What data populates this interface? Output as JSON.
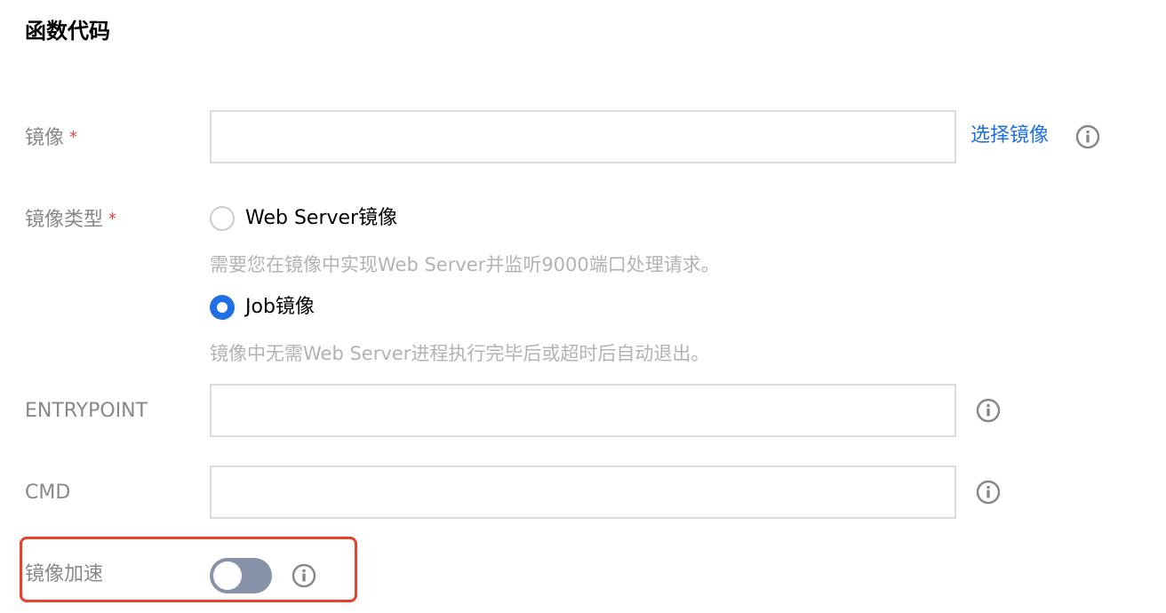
{
  "section": {
    "title": "函数代码"
  },
  "image": {
    "label": "镜像",
    "required_mark": "*",
    "value": "",
    "placeholder": "",
    "select_link": "选择镜像",
    "info_icon": "info-circle-icon"
  },
  "image_type": {
    "label": "镜像类型",
    "required_mark": "*",
    "options": [
      {
        "label": "Web Server镜像",
        "description": "需要您在镜像中实现Web Server并监听9000端口处理请求。",
        "checked": false
      },
      {
        "label": "Job镜像",
        "description": "镜像中无需Web Server进程执行完毕后或超时后自动退出。",
        "checked": true
      }
    ]
  },
  "entrypoint": {
    "label": "ENTRYPOINT",
    "value": "",
    "info_icon": "info-circle-icon"
  },
  "cmd": {
    "label": "CMD",
    "value": "",
    "info_icon": "info-circle-icon"
  },
  "acceleration": {
    "label": "镜像加速",
    "enabled": false,
    "info_icon": "info-circle-icon"
  },
  "colors": {
    "accent": "#1f6fe5",
    "required": "#e54545",
    "highlight": "#e8412c",
    "toggle_off": "#8792a8"
  }
}
